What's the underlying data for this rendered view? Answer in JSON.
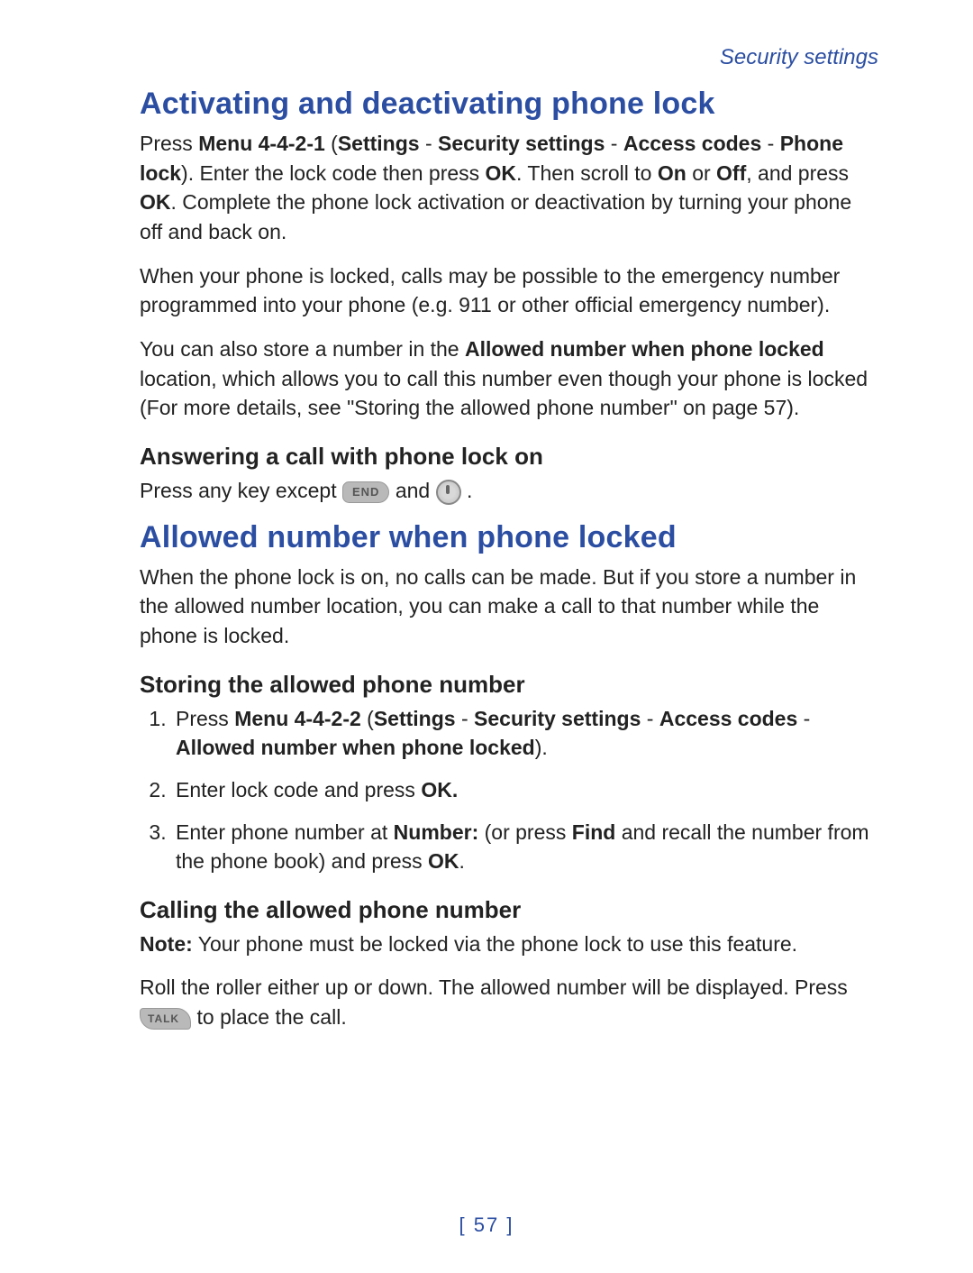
{
  "header": {
    "section": "Security settings"
  },
  "h1_activating": "Activating and deactivating phone lock",
  "p1": {
    "pre": "Press ",
    "menu": "Menu 4-4-2-1",
    "paren_open": " (",
    "settings": "Settings",
    "sep1": " - ",
    "security": "Security settings",
    "sep2": " - ",
    "access": "Access codes",
    "sep3": " - ",
    "phonelock": "Phone lock",
    "after1": "). Enter the lock code then press ",
    "ok1": "OK",
    "after2": ". Then scroll to ",
    "on": "On",
    "or": " or ",
    "off": "Off",
    "after3": ", and press ",
    "ok2": "OK",
    "after4": ". Complete the phone lock activation or deactivation by turning your phone off and back on."
  },
  "p2": "When your phone is locked, calls may be possible to the emergency number programmed into your phone (e.g. 911 or other official emergency number).",
  "p3": {
    "pre": "You can also store a number in the ",
    "bold": "Allowed number when phone locked",
    "after": " location, which allows you to call this number even though your phone is locked (For more details, see \"Storing the allowed phone number\" on page 57)."
  },
  "h2_answering": "Answering a call with phone lock on",
  "p4": {
    "pre": "Press any key except ",
    "mid": " and ",
    "end": " ."
  },
  "h1_allowed": "Allowed number when phone locked",
  "p5": "When the phone lock is on, no calls can be made. But if you store a number in the allowed number location, you can make a call to that number while the phone is locked.",
  "h2_storing": "Storing the allowed phone number",
  "list": {
    "i1": {
      "pre": "Press ",
      "menu": "Menu 4-4-2-2",
      "paren_open": " (",
      "settings": "Settings",
      "sep1": " - ",
      "security": "Security settings",
      "sep2": " - ",
      "access": "Access codes",
      "sep3": " - ",
      "allowed": "Allowed number when phone locked",
      "after": ")."
    },
    "i2": {
      "pre": "Enter lock code and press ",
      "ok": "OK."
    },
    "i3": {
      "pre": "Enter phone number at ",
      "number": "Number:",
      "mid": " (or press ",
      "find": "Find",
      "after1": " and recall the number from the phone book) and press ",
      "ok": "OK",
      "after2": "."
    }
  },
  "h2_calling": "Calling the allowed phone number",
  "p6": {
    "note": "Note:",
    "text": "  Your phone must be locked via the phone lock to use this feature."
  },
  "p7": {
    "pre": "Roll the roller either up or down. The allowed number will be displayed. Press ",
    "after": " to place the call."
  },
  "keys": {
    "end": "END",
    "talk": "TALK"
  },
  "page_number": "[ 57 ]"
}
